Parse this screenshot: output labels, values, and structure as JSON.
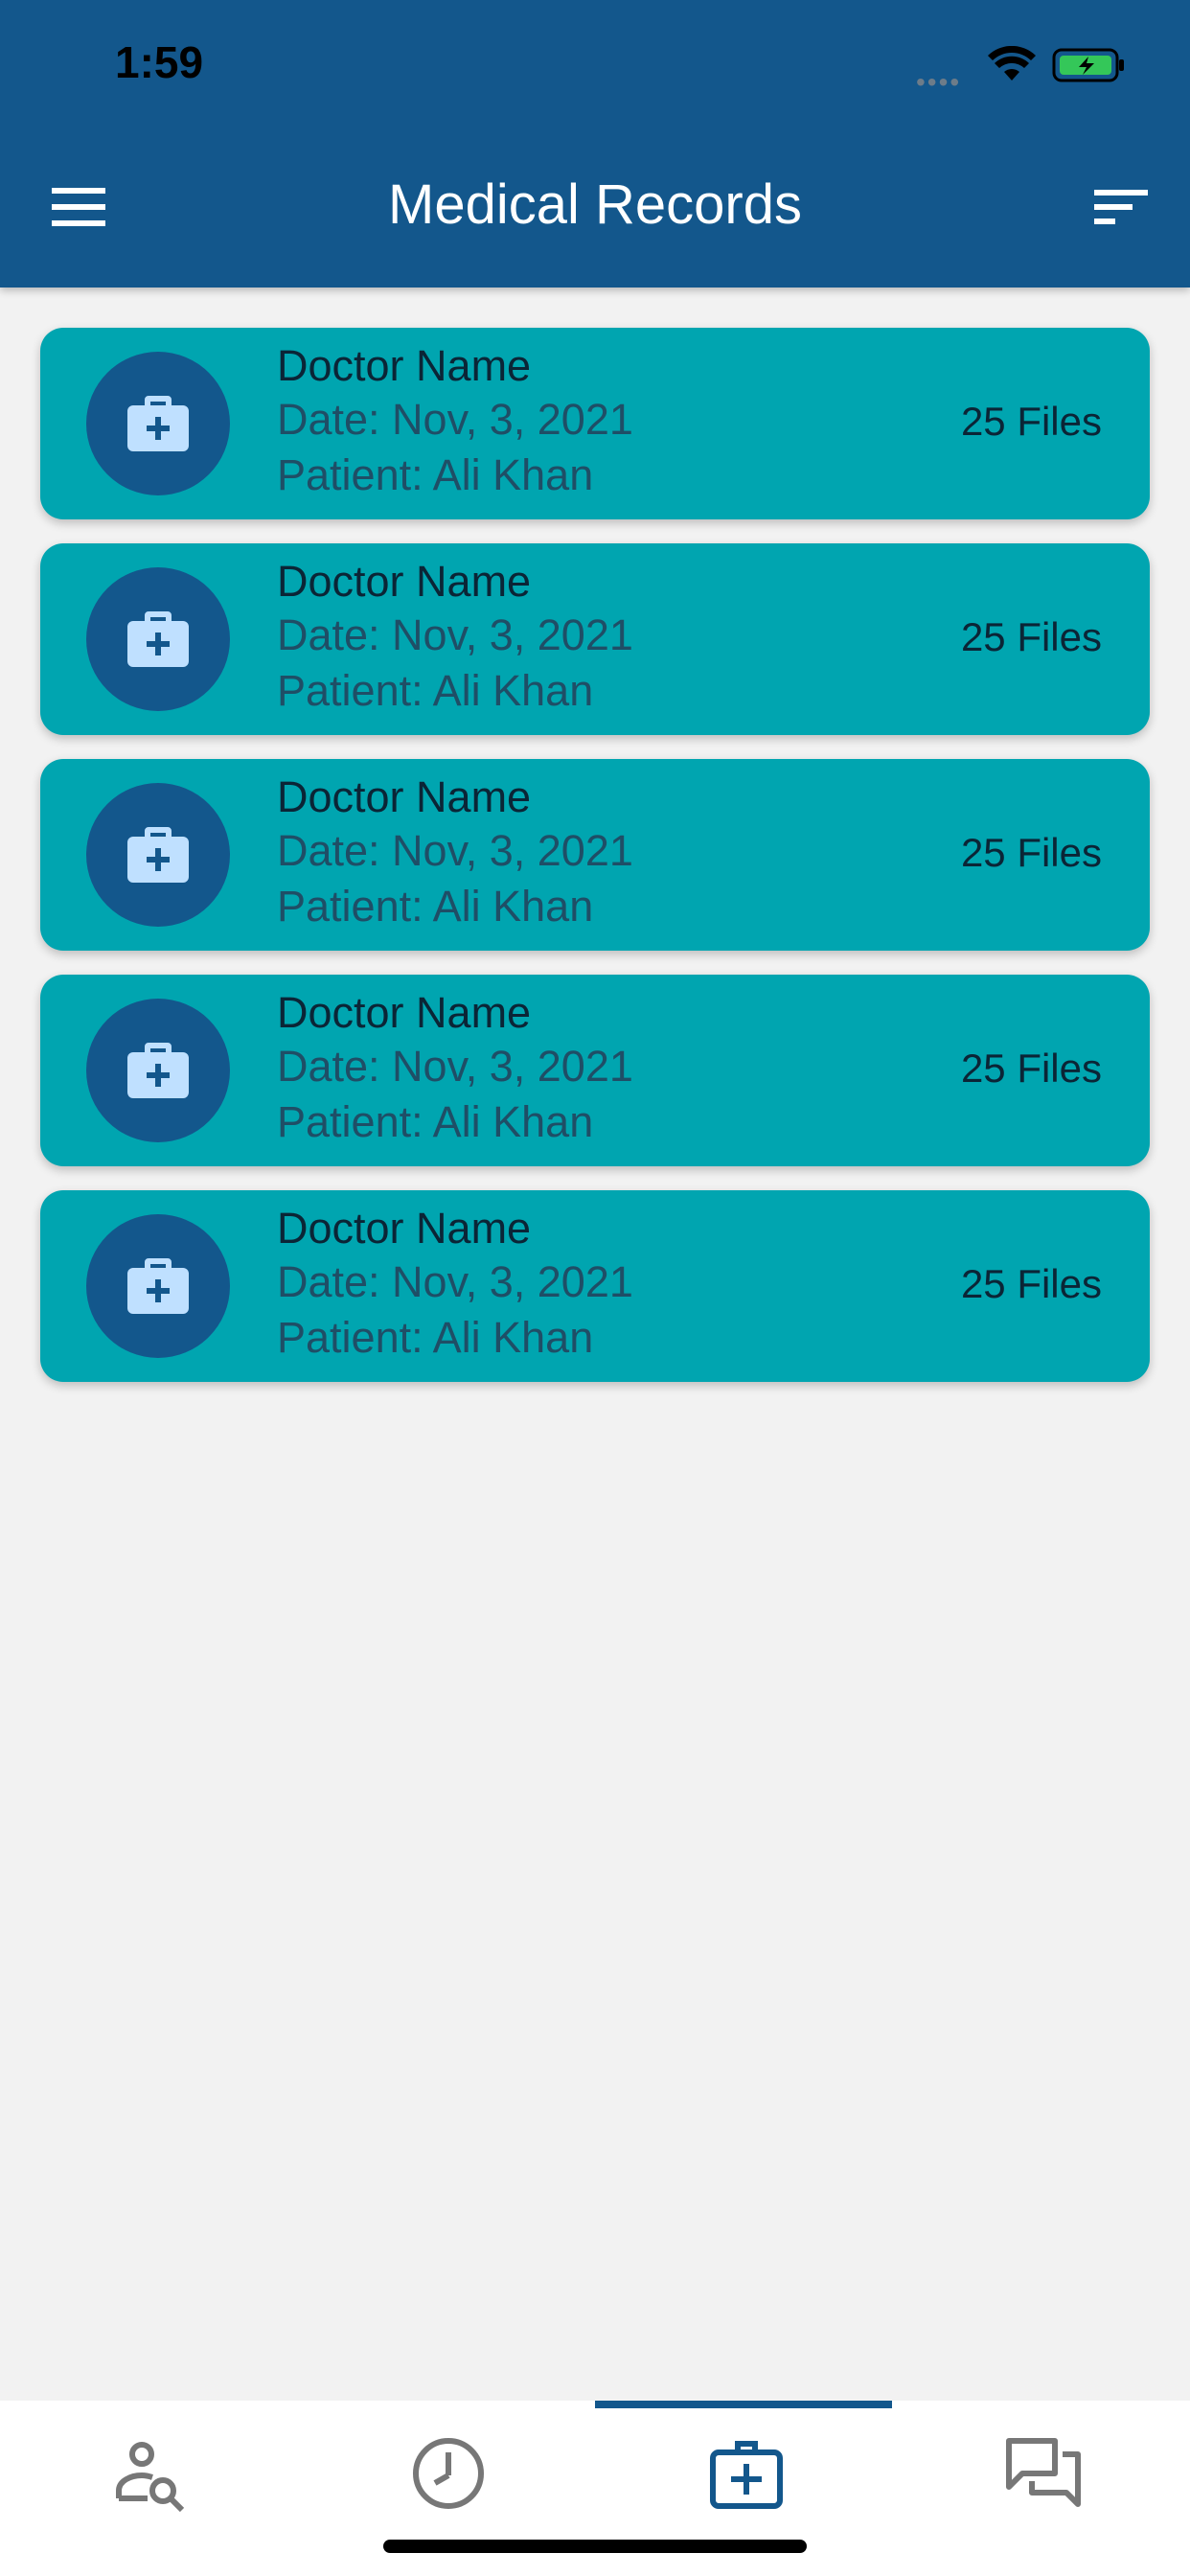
{
  "status_bar": {
    "time": "1:59"
  },
  "app_bar": {
    "title": "Medical Records"
  },
  "records": [
    {
      "doctor": "Doctor Name",
      "date": "Date: Nov, 3, 2021",
      "patient": "Patient: Ali Khan",
      "files": "25 Files"
    },
    {
      "doctor": "Doctor Name",
      "date": "Date: Nov, 3, 2021",
      "patient": "Patient: Ali Khan",
      "files": "25 Files"
    },
    {
      "doctor": "Doctor Name",
      "date": "Date: Nov, 3, 2021",
      "patient": "Patient: Ali Khan",
      "files": "25 Files"
    },
    {
      "doctor": "Doctor Name",
      "date": "Date: Nov, 3, 2021",
      "patient": "Patient: Ali Khan",
      "files": "25 Files"
    },
    {
      "doctor": "Doctor Name",
      "date": "Date: Nov, 3, 2021",
      "patient": "Patient: Ali Khan",
      "files": "25 Files"
    }
  ],
  "bottom_nav": {
    "items": [
      {
        "icon": "doctor-search-icon",
        "selected": false
      },
      {
        "icon": "history-clock-icon",
        "selected": false
      },
      {
        "icon": "medical-records-icon",
        "selected": true
      },
      {
        "icon": "chat-icon",
        "selected": false
      }
    ]
  },
  "colors": {
    "primary": "#13578c",
    "card": "#00a5b0",
    "background": "#f2f2f2"
  }
}
